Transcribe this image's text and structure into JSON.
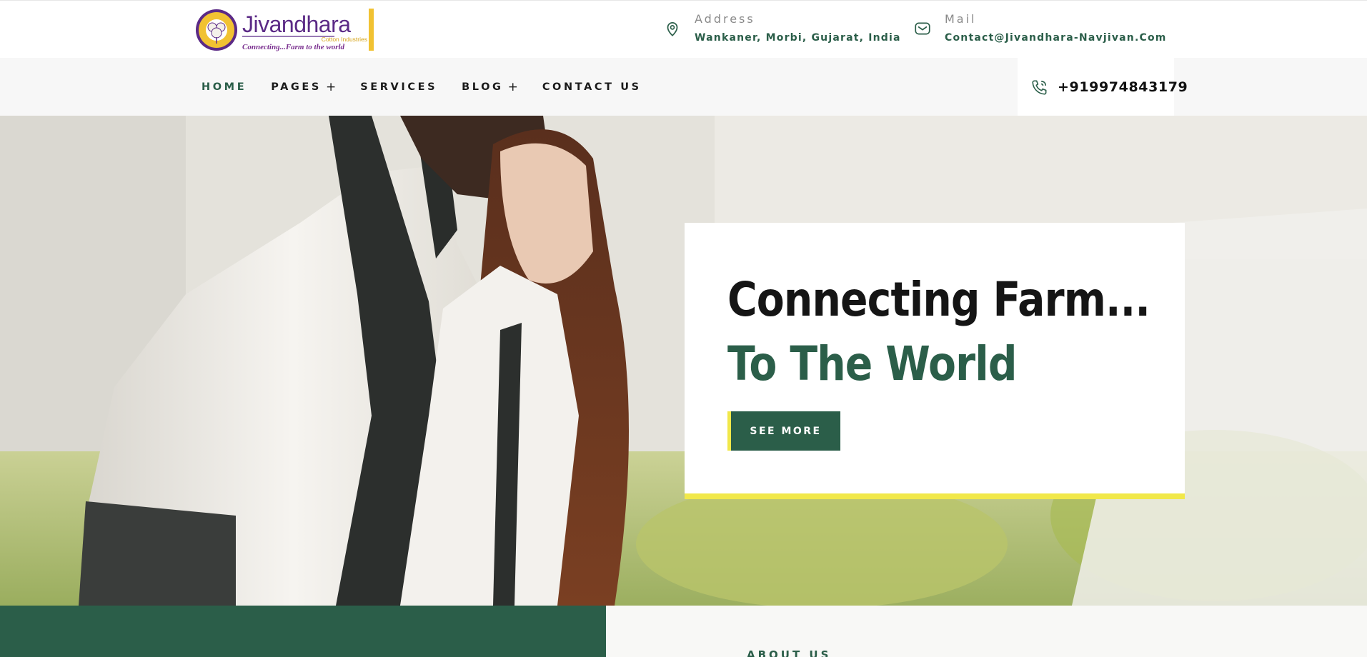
{
  "brand": {
    "name": "Jivandhara",
    "sub": "Cotton Industries",
    "tagline": "Connecting...Farm to the world",
    "colors": {
      "primary_green": "#2b5e49",
      "accent_yellow": "#f1e84a",
      "logo_yellow": "#f1c232",
      "logo_purple": "#5b2a86"
    }
  },
  "contacts": {
    "address": {
      "label": "Address",
      "value": "Wankaner, Morbi, Gujarat, India",
      "icon": "map-pin-icon"
    },
    "mail": {
      "label": "Mail",
      "value": "Contact@Jivandhara-Navjivan.Com",
      "icon": "mail-icon"
    }
  },
  "nav": {
    "items": [
      {
        "label": "HOME",
        "has_submenu": false,
        "active": true
      },
      {
        "label": "PAGES",
        "has_submenu": true
      },
      {
        "label": "SERVICES",
        "has_submenu": false
      },
      {
        "label": "BLOG",
        "has_submenu": true
      },
      {
        "label": "CONTACT US",
        "has_submenu": false
      }
    ],
    "submenu_glyph": "+",
    "phone": {
      "number": "+919974843179",
      "icon": "phone-icon"
    }
  },
  "hero": {
    "title_line1": "Connecting Farm...",
    "title_line2": "To The World",
    "button_label": "SEE MORE"
  },
  "about": {
    "label": "ABOUT US"
  }
}
